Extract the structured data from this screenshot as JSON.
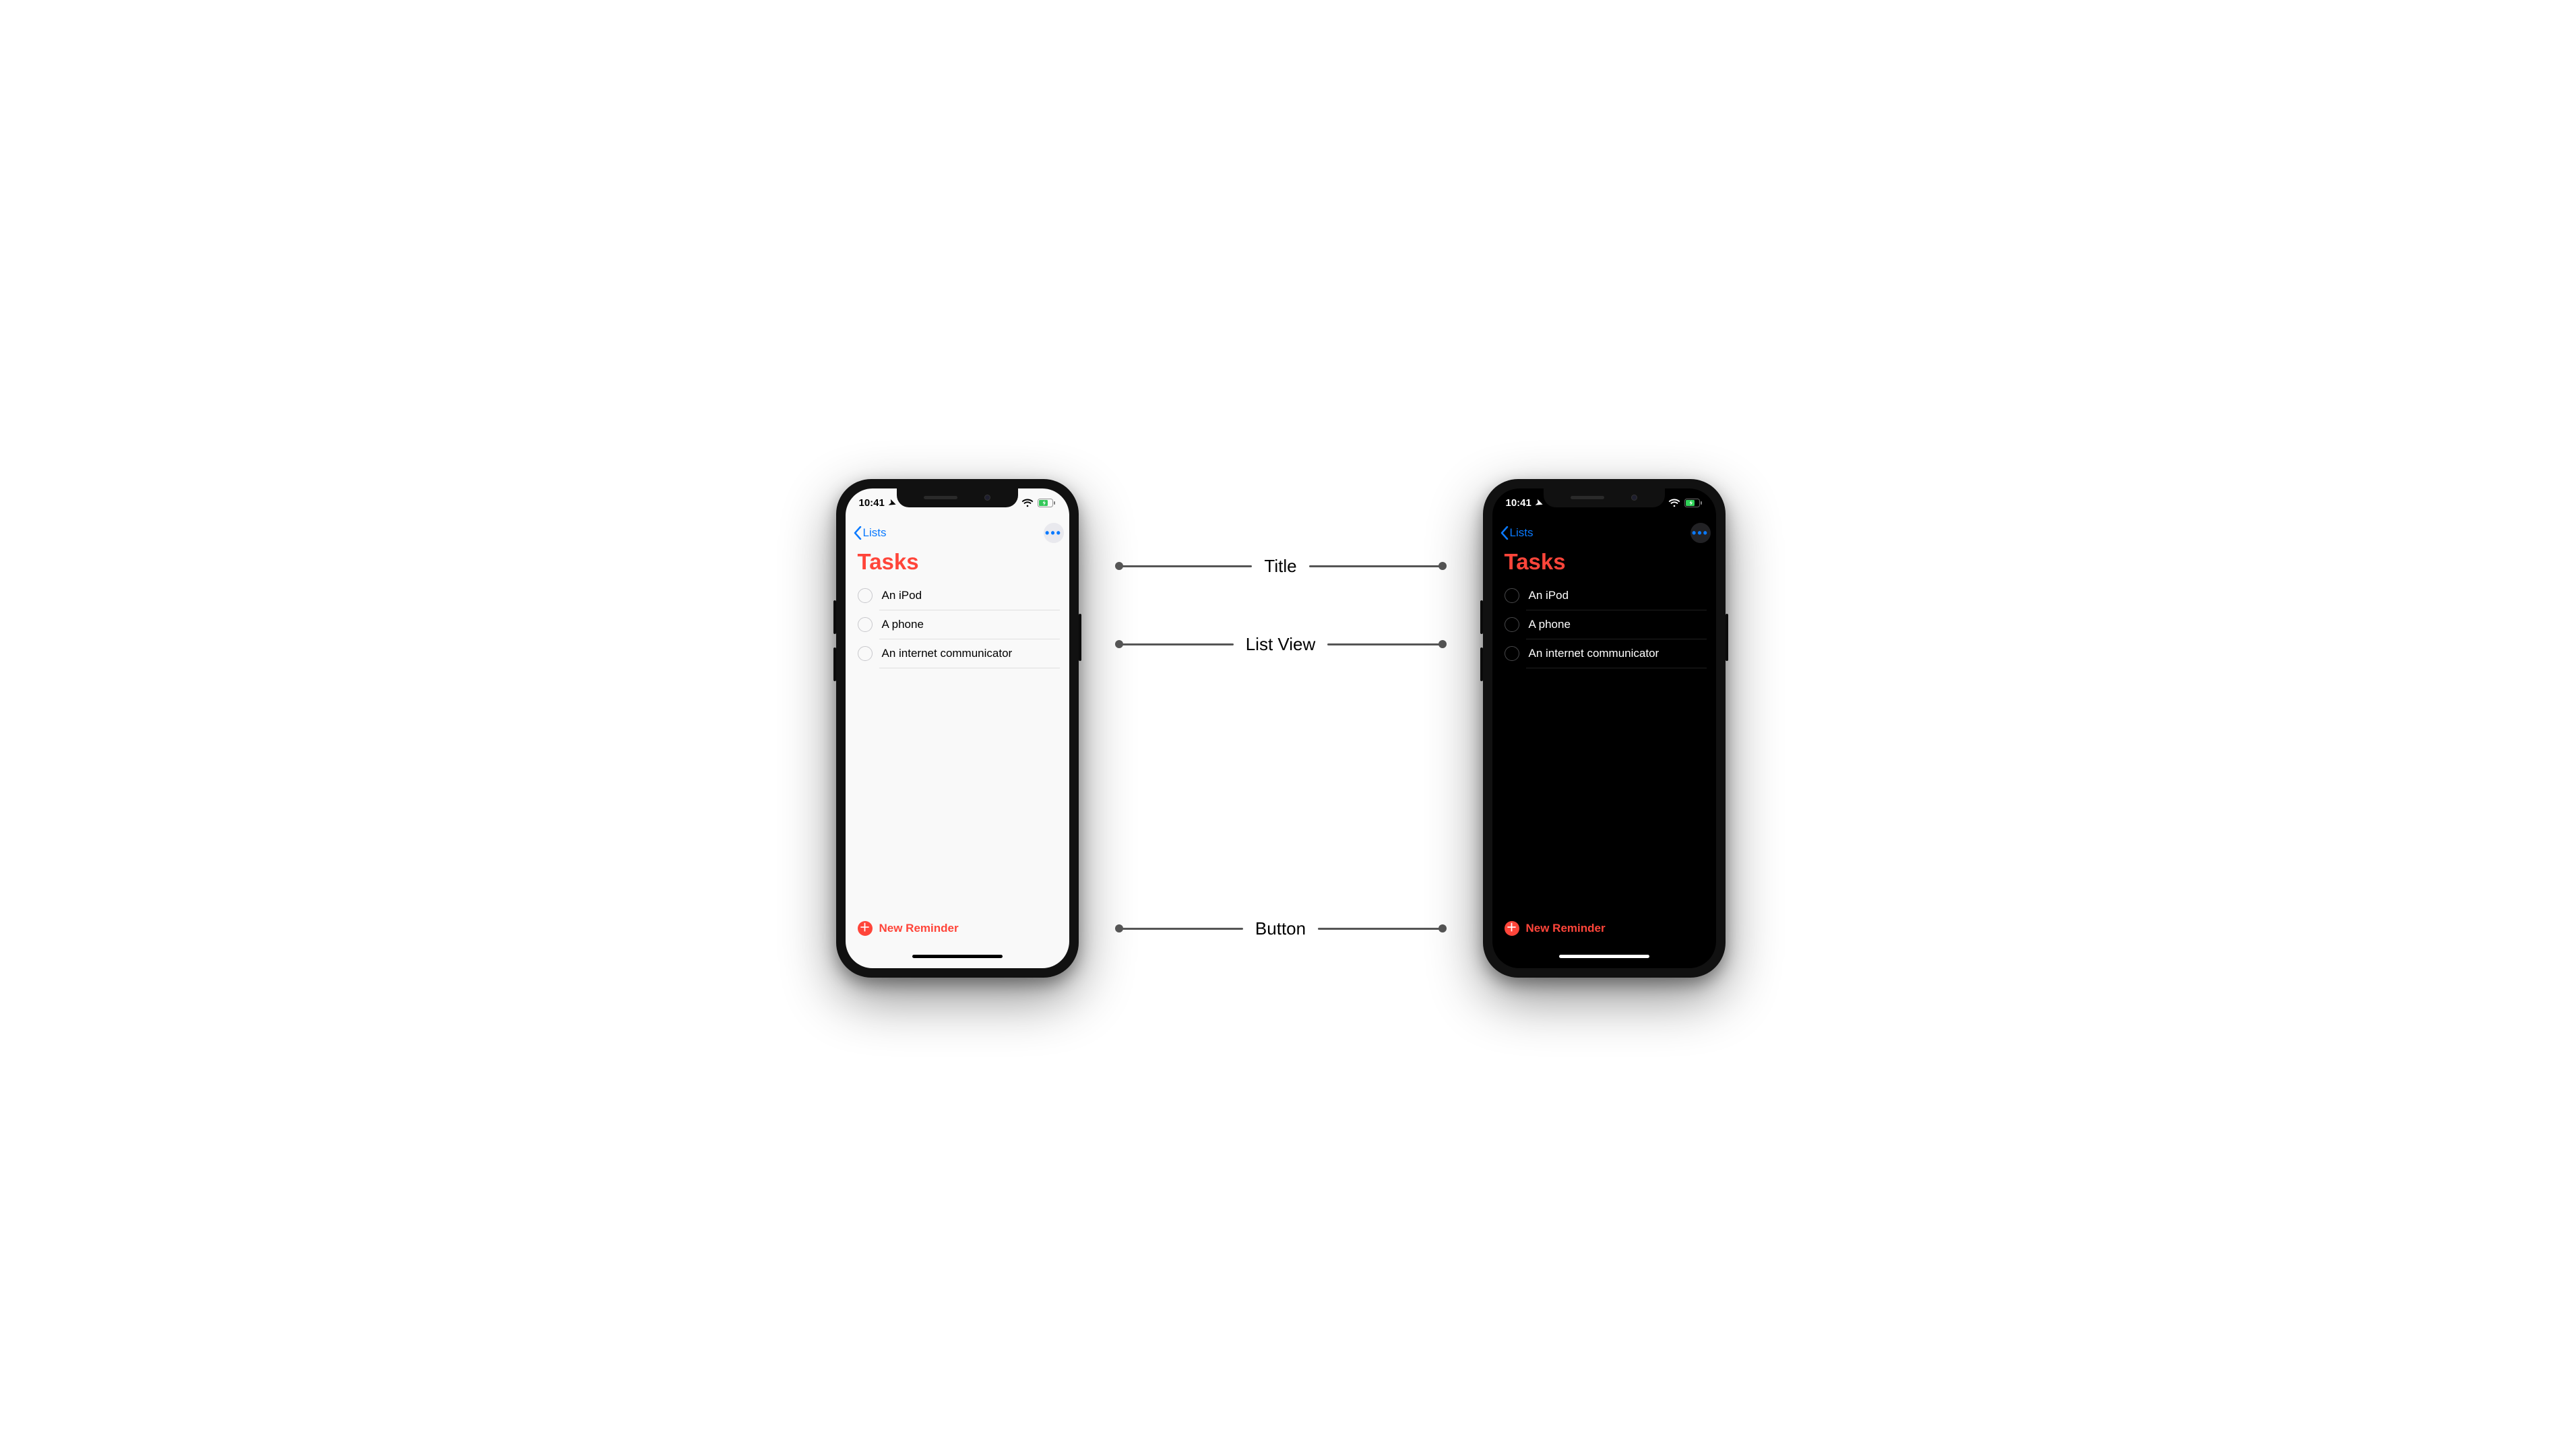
{
  "status": {
    "time": "10:41"
  },
  "nav": {
    "back_label": "Lists"
  },
  "page": {
    "title": "Tasks"
  },
  "colors": {
    "accent": "#ff453a",
    "link": "#0a7aff"
  },
  "tasks": [
    {
      "label": "An iPod"
    },
    {
      "label": "A phone"
    },
    {
      "label": "An internet communicator"
    }
  ],
  "toolbar": {
    "new_reminder_label": "New Reminder"
  },
  "annotations": {
    "title": "Title",
    "list": "List View",
    "button": "Button"
  }
}
